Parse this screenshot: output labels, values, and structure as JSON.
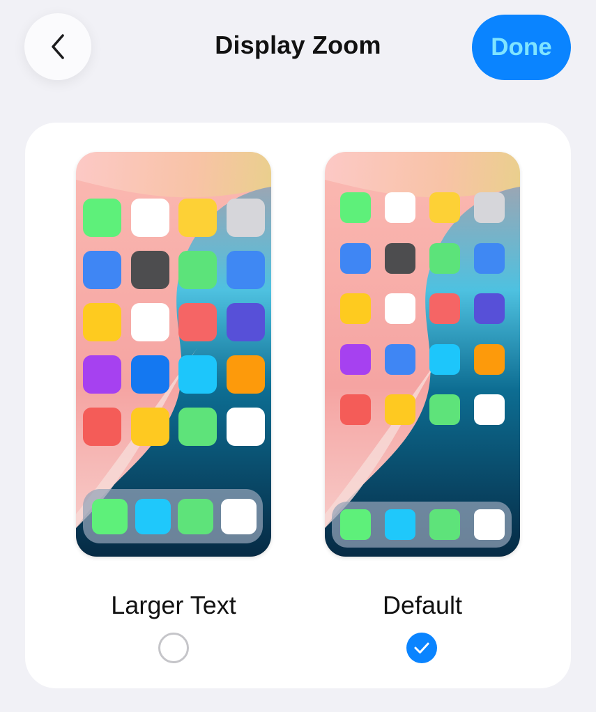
{
  "header": {
    "title": "Display Zoom",
    "back_icon": "chevron-left-icon",
    "done_label": "Done"
  },
  "colors": {
    "accent": "#0a84ff",
    "done_text": "#7fe4ff",
    "background": "#f1f1f6",
    "card": "#ffffff"
  },
  "options": [
    {
      "label": "Larger Text",
      "selected": false,
      "icon_rows": [
        [
          "#5ef07a",
          "#ffffff",
          "#fdd136",
          "#d6d6da"
        ],
        [
          "#3f86f4",
          "#4d4d4f",
          "#5ce37a",
          "#3f88f3"
        ],
        [
          "#fecb1f",
          "#ffffff",
          "#f56565",
          "#5750d8"
        ],
        [
          "#a641f0",
          "#1478f1",
          "#1dc6fb",
          "#fd9a0b"
        ],
        [
          "#f45c58",
          "#fec921",
          "#5ee37a",
          "#ffffff"
        ]
      ],
      "dock": [
        "#5ef07a",
        "#1fc8fb",
        "#5ee37a",
        "#ffffff"
      ]
    },
    {
      "label": "Default",
      "selected": true,
      "icon_rows": [
        [
          "#5ef07a",
          "#ffffff",
          "#fdd136",
          "#d6d6da"
        ],
        [
          "#3f86f4",
          "#4d4d4f",
          "#5ce37a",
          "#3f88f3"
        ],
        [
          "#fecb1f",
          "#ffffff",
          "#f56565",
          "#5750d8"
        ],
        [
          "#a641f0",
          "#3f86f4",
          "#1dc6fb",
          "#fd9a0b"
        ],
        [
          "#f45c58",
          "#fec921",
          "#5ee37a",
          "#ffffff"
        ]
      ],
      "dock": [
        "#5ef07a",
        "#1fc8fb",
        "#5ee37a",
        "#ffffff"
      ]
    }
  ]
}
